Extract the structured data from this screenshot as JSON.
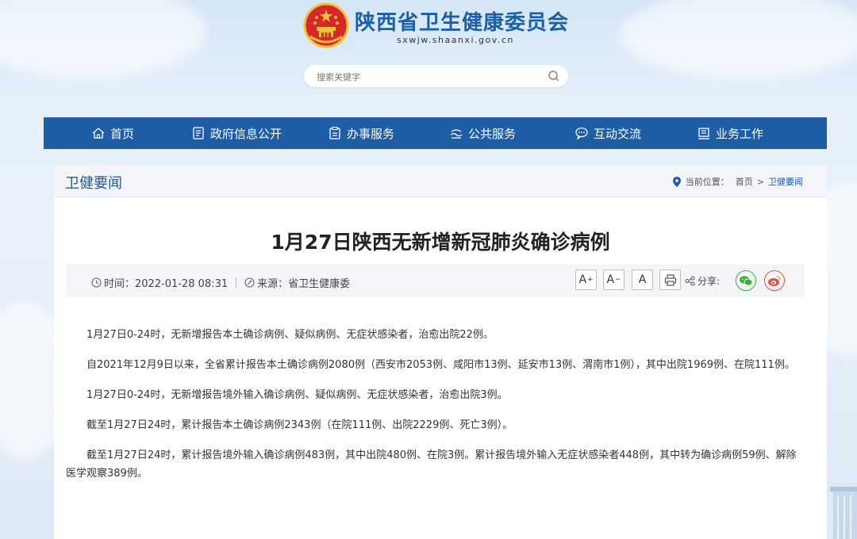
{
  "site": {
    "name": "陕西省卫生健康委员会",
    "domain": "sxwjw.shaanxi.gov.cn"
  },
  "search": {
    "placeholder": "搜索关键字"
  },
  "nav": {
    "items": [
      {
        "label": "首页",
        "icon": "home-icon"
      },
      {
        "label": "政府信息公开",
        "icon": "document-icon"
      },
      {
        "label": "办事服务",
        "icon": "service-icon"
      },
      {
        "label": "公共服务",
        "icon": "public-service-icon"
      },
      {
        "label": "互动交流",
        "icon": "chat-icon"
      },
      {
        "label": "业务工作",
        "icon": "work-icon"
      }
    ]
  },
  "section": {
    "title": "卫健要闻",
    "breadcrumb_prefix": "当前位置：",
    "breadcrumb": [
      "首页",
      "卫健要闻"
    ],
    "breadcrumb_sep": ">"
  },
  "article": {
    "title": "1月27日陕西无新增新冠肺炎确诊病例",
    "time": "时间：2022-01-28 08:31",
    "source": "来源：省卫生健康委",
    "font_larger": "A",
    "font_smaller": "A",
    "font_default": "A",
    "share_label": "分享:",
    "paragraphs": [
      "1月27日0-24时，无新增报告本土确诊病例、疑似病例、无症状感染者，治愈出院22例。",
      "自2021年12月9日以来，全省累计报告本土确诊病例2080例（西安市2053例、咸阳市13例、延安市13例、渭南市1例），其中出院1969例、在院111例。",
      "1月27日0-24时，无新增报告境外输入确诊病例、疑似病例、无症状感染者，治愈出院3例。",
      "截至1月27日24时，累计报告本土确诊病例2343例（在院111例、出院2229例、死亡3例）。",
      "截至1月27日24时，累计报告境外输入确诊病例483例，其中出院480例、在院3例。累计报告境外输入无症状感染者448例，其中转为确诊病例59例、解除医学观察389例。"
    ]
  },
  "colors": {
    "brand_blue": "#1d5ea6",
    "wechat_green": "#3cb034",
    "weibo_red": "#e6523c"
  }
}
